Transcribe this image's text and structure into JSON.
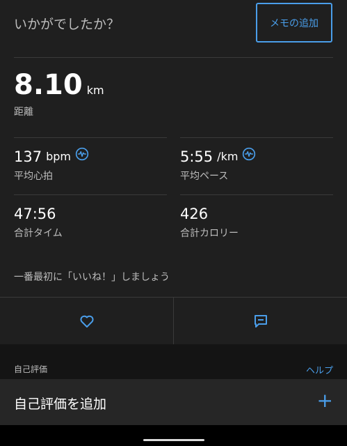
{
  "header": {
    "question": "いかがでしたか？",
    "memo_button": "メモの追加"
  },
  "distance": {
    "value": "8.10",
    "unit": "km",
    "label": "距離"
  },
  "stats": {
    "heart_rate": {
      "value": "137",
      "unit": "bpm",
      "label": "平均心拍"
    },
    "pace": {
      "value": "5:55",
      "unit": "/km",
      "label": "平均ペース"
    },
    "time": {
      "value": "47:56",
      "label": "合計タイム"
    },
    "calories": {
      "value": "426",
      "label": "合計カロリー"
    }
  },
  "like_message": "一番最初に「いいね！」しましょう",
  "actions": {
    "like_icon": "heart-icon",
    "comment_icon": "comment-icon"
  },
  "self_eval": {
    "section_title": "自己評価",
    "help": "ヘルプ",
    "add_label": "自己評価を追加",
    "add_icon": "+"
  },
  "colors": {
    "accent": "#4a9eea",
    "background": "#1f1f1f"
  }
}
